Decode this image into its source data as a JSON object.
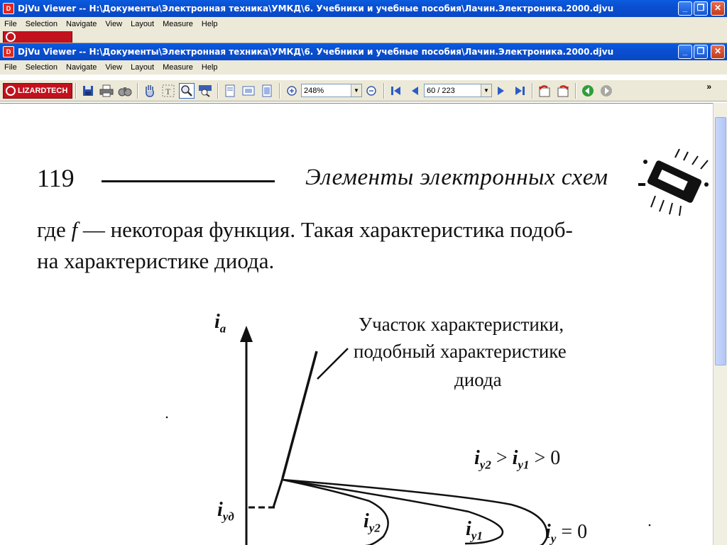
{
  "window_back": {
    "title": "DjVu Viewer -- H:\\Документы\\Электронная техника\\УМКД\\6. Учебники и учебные пособия\\Лачин.Электроника.2000.djvu",
    "menu": [
      "File",
      "Selection",
      "Navigate",
      "View",
      "Layout",
      "Measure",
      "Help"
    ]
  },
  "window": {
    "title": "DjVu Viewer -- H:\\Документы\\Электронная техника\\УМКД\\6. Учебники и учебные пособия\\Лачин.Электроника.2000.djvu",
    "menu": [
      "File",
      "Selection",
      "Navigate",
      "View",
      "Layout",
      "Measure",
      "Help"
    ],
    "buttons": {
      "minimize": "_",
      "maximize": "❐",
      "close": "✕"
    }
  },
  "toolbar": {
    "logo": "LIZARDTECH",
    "zoom": "248%",
    "page": "60 / 223",
    "overflow": "»"
  },
  "page": {
    "number": "119",
    "header_title": "Элементы электронных схем",
    "line1_prefix": "где ",
    "line1_var": "f",
    "line1_rest": " — некоторая функция. Такая характеристика подоб-",
    "line2": "на характеристике диода.",
    "figure": {
      "y_axis_label": "i",
      "y_axis_sub": "a",
      "annotation_lines": [
        "Участок характеристики,",
        "подобный характеристике",
        "диода"
      ],
      "relation_a": "i",
      "relation_a_sub": "y2",
      "relation_gt1": " > ",
      "relation_b": "i",
      "relation_b_sub": "y1",
      "relation_rest": " > 0",
      "iyd": "i",
      "iyd_sub": "yд",
      "curve_iy2": "i",
      "curve_iy2_sub": "y2",
      "curve_iy1": "i",
      "curve_iy1_sub": "y1",
      "curve_iy0": "i",
      "curve_iy0_sub": "y",
      "curve_iy0_rest": " = 0"
    }
  },
  "colors": {
    "titlebar": "#0a4fd0",
    "chrome": "#ece9d8",
    "logo": "#c2121d"
  }
}
